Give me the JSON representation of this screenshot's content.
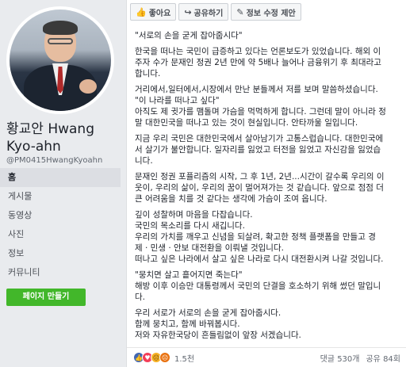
{
  "profile": {
    "name": "황교안 Hwang Kyo-ahn",
    "handle": "@PM0415HwangKyoahn"
  },
  "nav": {
    "items": [
      {
        "label": "홈",
        "active": true
      },
      {
        "label": "게시물"
      },
      {
        "label": "동영상"
      },
      {
        "label": "사진"
      },
      {
        "label": "정보"
      },
      {
        "label": "커뮤니티"
      }
    ],
    "create_page_label": "페이지 만들기"
  },
  "toolbar": {
    "like_label": "좋아요",
    "share_label": "공유하기",
    "suggest_edit_label": "정보 수정 제안"
  },
  "post": {
    "paragraphs": [
      [
        "\"서로의 손을 굳게 잡아줍시다\""
      ],
      [
        "한국을 떠나는 국민이 급증하고 있다는 언론보도가 있었습니다. 해외 이",
        "주자 수가 문재인 정권 2년 만에 약 5배나 늘어나 금융위기 후 최대라고",
        "합니다."
      ],
      [
        "거리에서,일터에서,시장에서 만난 분들께서 저를 보며 말씀하셨습니다.",
        "\"이 나라를 떠나고 싶다\"",
        "아직도 제 귓가를 맴돌며 가슴을 먹먹하게 합니다. 그런데 말이 아니라 정",
        "말 대한민국을 떠나고 있는 것이 현실입니다. 안타까울 일입니다."
      ],
      [
        "지금 우리 국민은 대한민국에서 살아남기가 고통스럽습니다. 대한민국에",
        "서 살기가 불안합니다. 일자리를 잃었고 터전을 잃었고 자신감을 잃었습",
        "니다."
      ],
      [
        "문재인 정권 포퓰리즘의 시작, 그 후 1년, 2년...시간이 갈수록 우리의 이",
        "웃이, 우리의 삶이, 우리의 꿈이 멀어져가는 것 같습니다. 앞으로 점점 더",
        "큰 어려움을 치를 것 같다는 생각에 가슴이 조여 옵니다."
      ],
      [
        "깊이 성찰하며 마음을 다잡습니다.",
        "국민의 목소리를 다시 새깁니다.",
        "우리의 가치를 깨우고 신념을 되살려, 확고한 정책 플랫폼을 만들고 경",
        "제 · 민생 · 안보 대전환을 이뤄낼 것입니다.",
        "떠나고 싶은 나라에서 살고 싶은 나라로 다시 대전환시켜 나갈 것입니다."
      ],
      [
        "\"뭉치면 살고 흩어지면 죽는다\"",
        "해방 이후 이승만 대통령께서 국민의 단결을 호소하기 위해 썼던 말입니",
        "다."
      ],
      [
        "우리 서로가 서로의 손을 굳게 잡아줍시다.",
        "함께 뭉치고, 함께 바꿔봅시다.",
        "저와 자유한국당이 흔들림없이 앞장 서겠습니다."
      ]
    ]
  },
  "footer": {
    "reaction_count": "1.5천",
    "comments": "댓글 530개",
    "shares": "공유 84회"
  },
  "colors": {
    "create_button": "#42b72a",
    "like": "#4267b2"
  }
}
